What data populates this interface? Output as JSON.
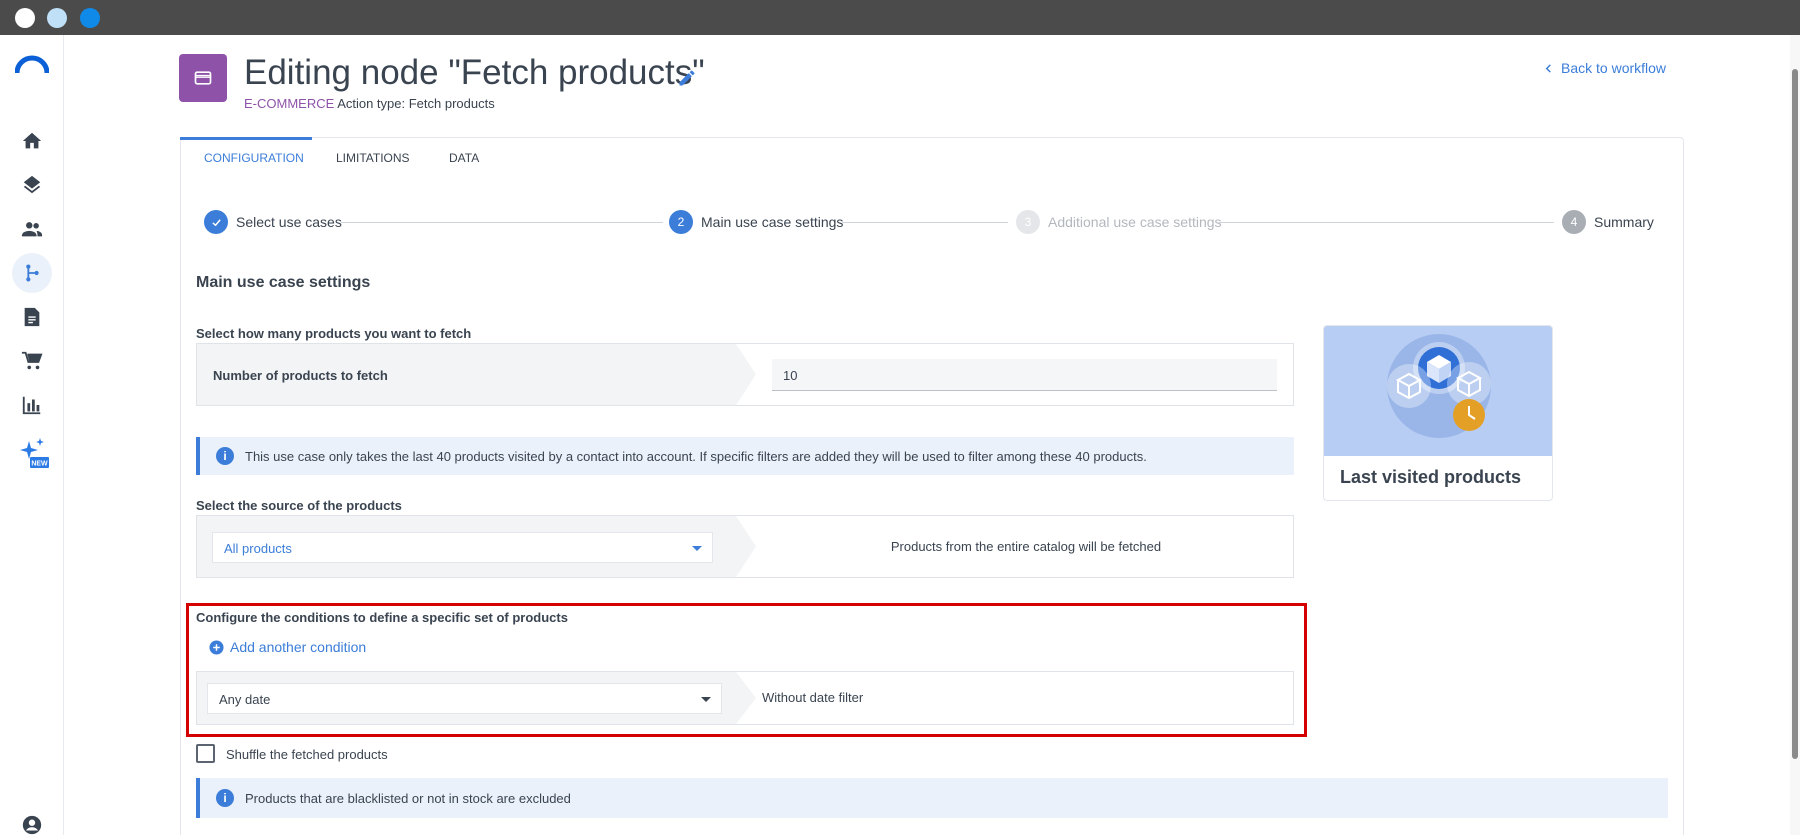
{
  "window": {
    "title": ""
  },
  "sidebar": {
    "items": [
      {
        "icon": "home-icon",
        "active": false
      },
      {
        "icon": "layers-icon",
        "active": false
      },
      {
        "icon": "contacts-icon",
        "active": false
      },
      {
        "icon": "workflow-icon",
        "active": true
      },
      {
        "icon": "document-icon",
        "active": false
      },
      {
        "icon": "cart-icon",
        "active": false
      },
      {
        "icon": "bar-chart-icon",
        "active": false
      },
      {
        "icon": "ai-sparkle-icon",
        "active": false,
        "badge": "NEW"
      }
    ],
    "bottom_icon": "account-icon"
  },
  "header": {
    "title": "Editing node \"Fetch products\"",
    "category": "E-COMMERCE",
    "action_type": "Action type: Fetch products",
    "back_link": "Back to workflow"
  },
  "tabs": [
    {
      "label": "CONFIGURATION",
      "active": true
    },
    {
      "label": "LIMITATIONS",
      "active": false
    },
    {
      "label": "DATA",
      "active": false
    }
  ],
  "stepper": [
    {
      "number": "",
      "label": "Select use cases",
      "state": "done"
    },
    {
      "number": "2",
      "label": "Main use case settings",
      "state": "current"
    },
    {
      "number": "3",
      "label": "Additional use case settings",
      "state": "disabled"
    },
    {
      "number": "4",
      "label": "Summary",
      "state": "upcoming"
    }
  ],
  "main": {
    "section_title": "Main use case settings",
    "count_field": {
      "label": "Select how many products you want to fetch",
      "row_label": "Number of products to fetch",
      "value": "10"
    },
    "info_1": "This use case only takes the last 40 products visited by a contact into account. If specific filters are added they will be used to filter among these 40 products.",
    "source_field": {
      "label": "Select the source of the products",
      "selected": "All products",
      "description": "Products from the entire catalog will be fetched"
    },
    "conditions": {
      "label": "Configure the conditions to define a specific set of products",
      "add_condition": "Add another condition",
      "date_selected": "Any date",
      "date_description": "Without date filter"
    },
    "shuffle_label": "Shuffle the fetched products",
    "shuffle_checked": false,
    "info_2": "Products that are blacklisted or not in stock are excluded"
  },
  "preview": {
    "title": "Last visited products"
  },
  "colors": {
    "accent": "#3b7dd8",
    "ecommerce": "#8e53a8",
    "highlight": "#d40000",
    "clock": "#e4a026"
  }
}
